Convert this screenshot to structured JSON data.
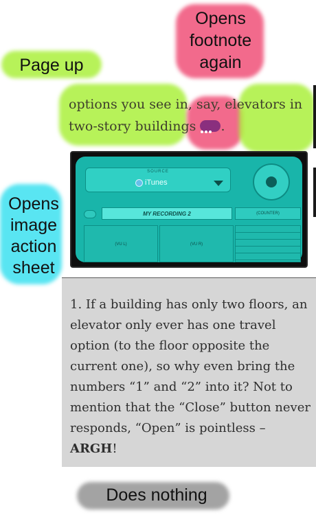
{
  "annotations": {
    "page_up": "Page up",
    "footnote_again_1": "Opens",
    "footnote_again_2": "footnote",
    "footnote_again_3": "again",
    "image_action_1": "Opens",
    "image_action_2": "image",
    "image_action_3": "action",
    "image_action_4": "sheet",
    "does_nothing": "Does nothing"
  },
  "book": {
    "line1": "options you see in, say, elevators in",
    "line2": "two-story buildings",
    "line2_end": "."
  },
  "image": {
    "source_label": "SOURCE",
    "source_value": "iTunes",
    "recording_name": "MY RECORDING 2",
    "counter": "(COUNTER)",
    "vu_left": "(VU L)",
    "vu_right": "(VU R)"
  },
  "footnote": {
    "text": "1. If a building has only two floors, an elevator only ever has one travel option (to the floor opposite the current one), so why even bring the numbers “1” and “2” into it? Not to mention that the “Close” button never responds, “Open” is pointless – ",
    "bold": "ARGH",
    "end": "!"
  },
  "colors": {
    "highlight_green": "#aaf03c",
    "highlight_pink": "#f05078",
    "highlight_cyan": "#3ce1f0",
    "highlight_gray": "#8c8c8c",
    "footnote_marker": "#8a2f7e",
    "app_teal": "#19b5aa"
  }
}
